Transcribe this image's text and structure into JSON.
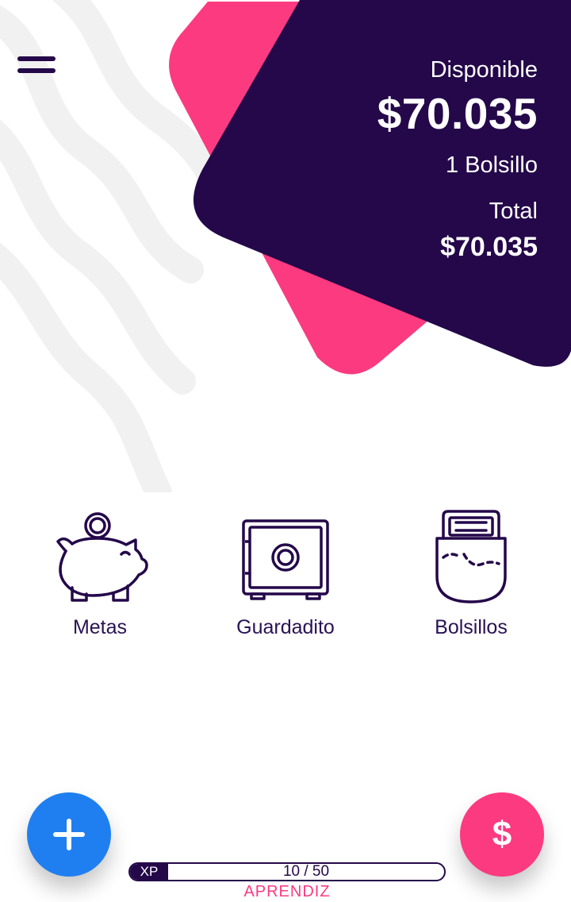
{
  "colors": {
    "primary": "#24084a",
    "accent_pink": "#fc3a80",
    "accent_blue": "#1f7ff0"
  },
  "header": {
    "menu_icon": "hamburger-menu-icon"
  },
  "balance": {
    "available_label": "Disponible",
    "available_amount": "$70.035",
    "pockets_count": "1 Bolsillo",
    "total_label": "Total",
    "total_amount": "$70.035"
  },
  "features": [
    {
      "label": "Metas",
      "icon": "piggy-bank-icon"
    },
    {
      "label": "Guardadito",
      "icon": "safe-icon"
    },
    {
      "label": "Bolsillos",
      "icon": "pocket-icon"
    }
  ],
  "fabs": {
    "add_icon": "plus-icon",
    "money_symbol": "$"
  },
  "xp": {
    "tag": "XP",
    "current": 10,
    "max": 50,
    "progress_text": "10 / 50",
    "level": "APRENDIZ"
  }
}
